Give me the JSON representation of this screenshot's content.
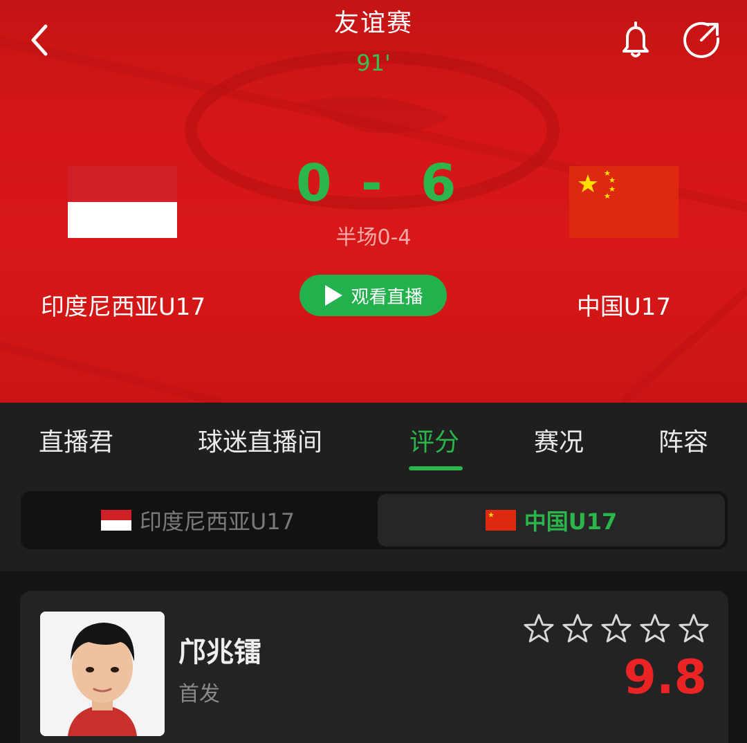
{
  "header": {
    "title": "友谊赛",
    "minute": "91'"
  },
  "match": {
    "home_team": "印度尼西亚U17",
    "away_team": "中国U17",
    "home_score": "0",
    "dash": "-",
    "away_score": "6",
    "halftime": "半场0-4",
    "watch_label": "观看直播"
  },
  "tabs": [
    {
      "label": "直播君",
      "active": false
    },
    {
      "label": "球迷直播间",
      "active": false
    },
    {
      "label": "评分",
      "active": true
    },
    {
      "label": "赛况",
      "active": false
    },
    {
      "label": "阵容",
      "active": false
    }
  ],
  "team_switch": {
    "home_label": "印度尼西亚U17",
    "away_label": "中国U17",
    "selected": "away"
  },
  "player": {
    "name": "邝兆镭",
    "role": "首发",
    "rating": "9.8",
    "stars_filled": 0,
    "stars_total": 5
  },
  "colors": {
    "accent_green": "#2bb54a",
    "hero_red": "#d51616",
    "rating_red": "#ea2424"
  },
  "icons": [
    "back-arrow-icon",
    "bell-icon",
    "share-icon",
    "play-icon",
    "star-icon"
  ]
}
